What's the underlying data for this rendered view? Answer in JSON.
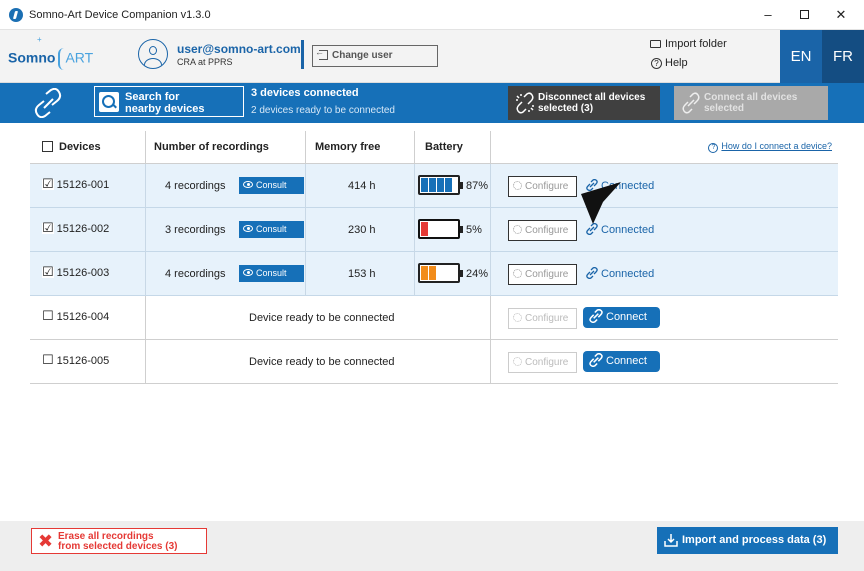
{
  "window": {
    "title": "Somno-Art Device Companion v1.3.0",
    "controls": {
      "minimize": "–",
      "maximize": "",
      "close": "✕"
    }
  },
  "header": {
    "logo_part1": "Somno",
    "logo_part2": "ART",
    "logo_star": "+",
    "user_email": "user@somno-art.com",
    "user_role": "CRA at PPRS",
    "change_user_label": "Change user",
    "import_folder_label": "Import folder",
    "help_label": "Help",
    "lang_en": "EN",
    "lang_fr": "FR"
  },
  "toolbar": {
    "search_label_line1": "Search for",
    "search_label_line2": "nearby devices",
    "status_connected": "3 devices connected",
    "status_ready": "2 devices ready to be connected",
    "disconnect_line1": "Disconnect all devices",
    "disconnect_line2": "selected (3)",
    "connect_all_line1": "Connect all devices",
    "connect_all_line2": "selected"
  },
  "table": {
    "headers": {
      "devices": "Devices",
      "recordings": "Number of recordings",
      "memory": "Memory free",
      "battery": "Battery"
    },
    "help_link": "How do I connect a device?",
    "consult_label": "Consult",
    "configure_label": "Configure",
    "connected_label": "Connected",
    "connect_label": "Connect",
    "rows": [
      {
        "id": "15126-001",
        "checked": "☑",
        "recordings": "4 recordings",
        "memory": "414 h",
        "battery": "87%",
        "battery_level": 0.87,
        "battery_color": "#1670b8"
      },
      {
        "id": "15126-002",
        "checked": "☑",
        "recordings": "3 recordings",
        "memory": "230 h",
        "battery": "5%",
        "battery_level": 0.05,
        "battery_color": "#e53935"
      },
      {
        "id": "15126-003",
        "checked": "☑",
        "recordings": "4 recordings",
        "memory": "153 h",
        "battery": "24%",
        "battery_level": 0.24,
        "battery_color": "#f28c1a"
      },
      {
        "id": "15126-004",
        "checked": "☐",
        "status": "Device ready to be connected"
      },
      {
        "id": "15126-005",
        "checked": "☐",
        "status": "Device ready to be connected"
      }
    ]
  },
  "footer": {
    "erase_line1": "Erase all recordings",
    "erase_line2": "from selected devices (3)",
    "import_label": "Import and process data (3)"
  },
  "colors": {
    "primary": "#1670b8",
    "dark_button": "#404040",
    "disabled_button": "#a9a9a9",
    "danger": "#e53935",
    "selected_row": "#e7f2fb"
  }
}
